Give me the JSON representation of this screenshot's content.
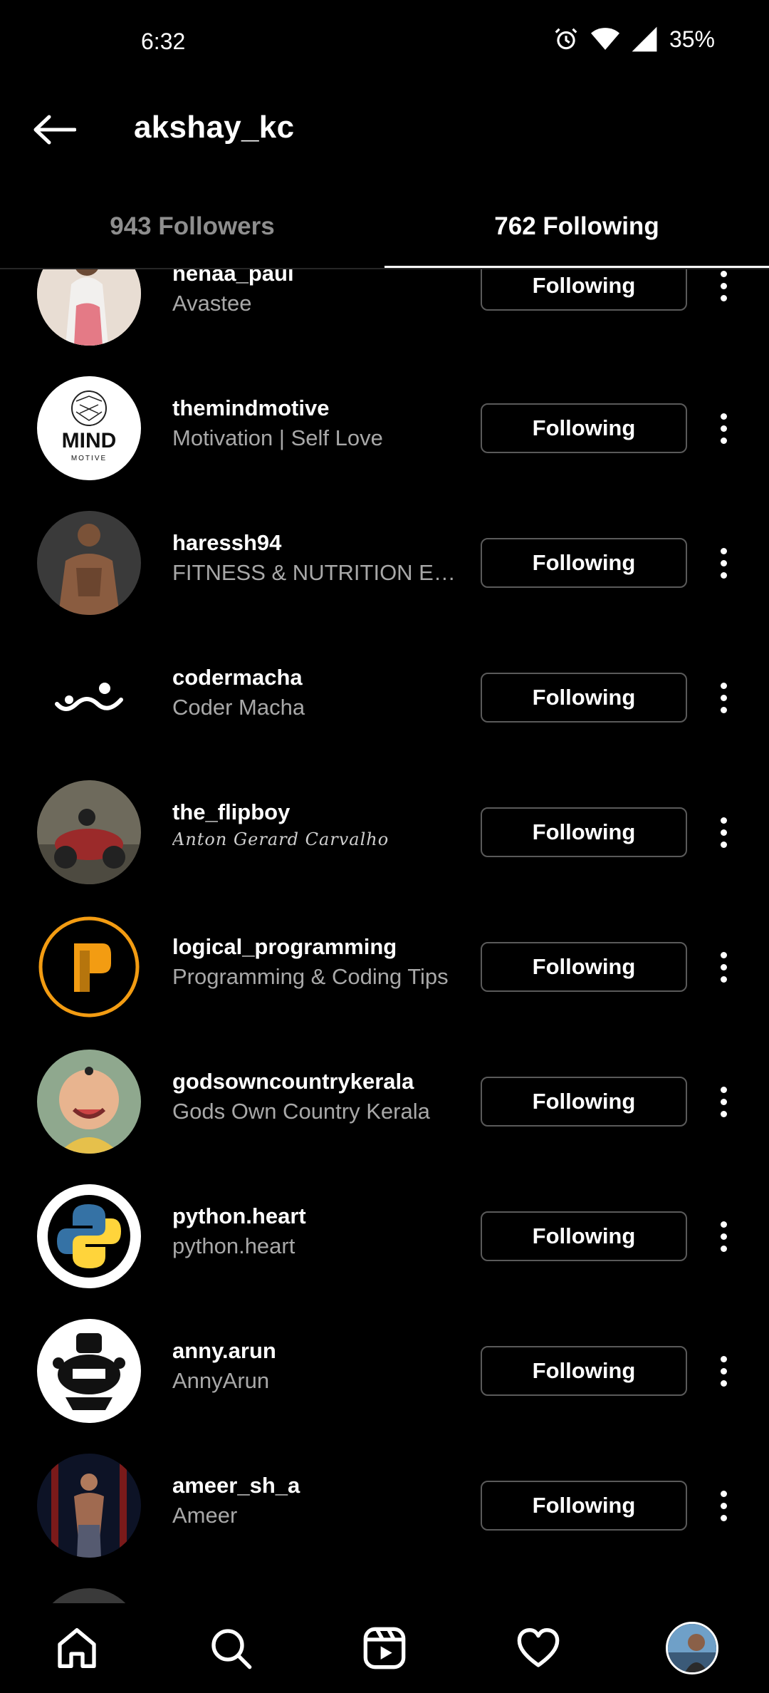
{
  "status_bar": {
    "time": "6:32",
    "battery": "35%"
  },
  "header": {
    "title": "akshay_kc"
  },
  "tabs": [
    {
      "label": "943 Followers",
      "active": false
    },
    {
      "label": "762 Following",
      "active": true
    }
  ],
  "button_label": "Following",
  "rows": [
    {
      "username": "nehaa_paul",
      "fullname": "Avastee"
    },
    {
      "username": "themindmotive",
      "fullname": "Motivation | Self Love"
    },
    {
      "username": "haressh94",
      "fullname": "FITNESS & NUTRITION EXP..."
    },
    {
      "username": "codermacha",
      "fullname": "Coder Macha"
    },
    {
      "username": "the_flipboy",
      "fullname": "Anton Gerard Carvalho"
    },
    {
      "username": "logical_programming",
      "fullname": "Programming & Coding Tips"
    },
    {
      "username": "godsowncountrykerala",
      "fullname": "Gods Own Country Kerala"
    },
    {
      "username": "python.heart",
      "fullname": "python.heart"
    },
    {
      "username": "anny.arun",
      "fullname": "AnnyArun"
    },
    {
      "username": "ameer_sh_a",
      "fullname": "Ameer"
    }
  ],
  "avatar_texts": {
    "mind_logo": "MIND",
    "mind_sub": "MOTIVE"
  },
  "nav": [
    "home-icon",
    "search-icon",
    "reels-icon",
    "heart-icon",
    "profile-avatar"
  ]
}
